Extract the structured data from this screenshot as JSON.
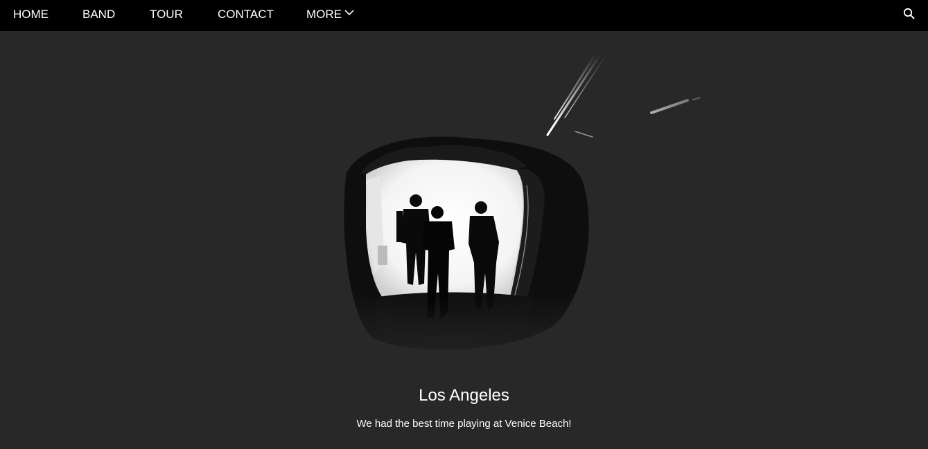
{
  "nav": {
    "items": [
      {
        "label": "HOME"
      },
      {
        "label": "BAND"
      },
      {
        "label": "TOUR"
      },
      {
        "label": "CONTACT"
      },
      {
        "label": "MORE"
      }
    ],
    "more_icon": "chevron-down-icon",
    "search_icon": "search-icon"
  },
  "hero": {
    "image": "band-silhouettes-in-tunnel-photo"
  },
  "caption": {
    "title": "Los Angeles",
    "text": "We had the best time playing at Venice Beach!"
  },
  "colors": {
    "navbar": "#000000",
    "background": "#282828",
    "text": "#ffffff"
  }
}
